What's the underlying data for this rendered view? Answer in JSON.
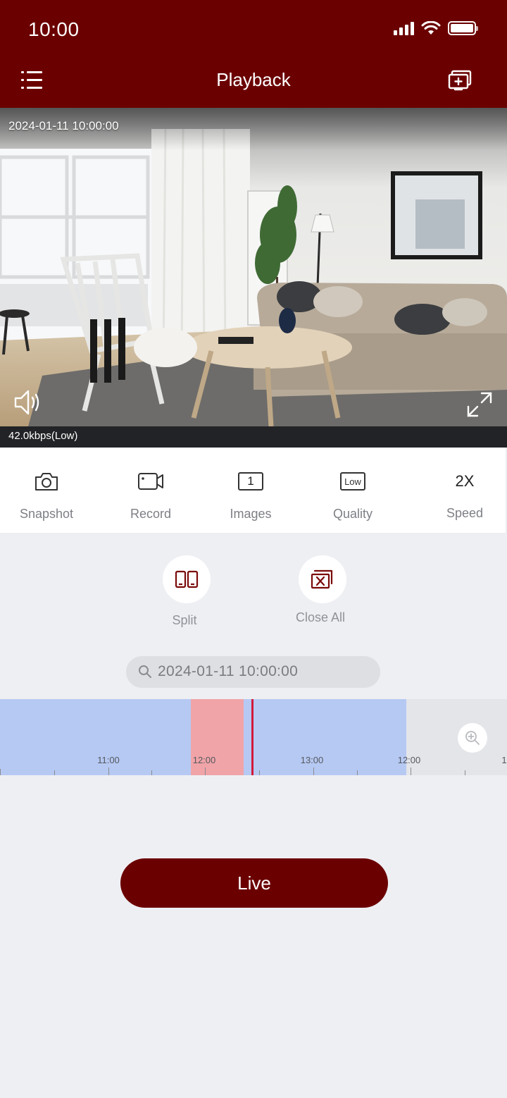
{
  "status_bar": {
    "time": "10:00",
    "icons": [
      "signal-icon",
      "wifi-icon",
      "battery-icon"
    ]
  },
  "header": {
    "title": "Playback",
    "left_icon": "menu-icon",
    "right_icon": "screen-add-icon",
    "background": "#6b0000"
  },
  "video": {
    "timestamp": "2024-01-11 10:00:00",
    "bitrate": "42.0kbps(Low)",
    "sound_icon": "speaker-icon",
    "fullscreen_icon": "expand-icon"
  },
  "toolbar": {
    "items": [
      {
        "label": "Snapshot",
        "icon": "camera-icon"
      },
      {
        "label": "Record",
        "icon": "video-camera-icon"
      },
      {
        "label": "Images",
        "icon": "image-count-icon",
        "badge": "1"
      },
      {
        "label": "Quality",
        "icon": "quality-icon",
        "badge": "Low"
      },
      {
        "label": "Speed",
        "value": "2X"
      }
    ]
  },
  "actions": {
    "split_label": "Split",
    "close_all_label": "Close All"
  },
  "search": {
    "value": "2024-01-11 10:00:00",
    "icon": "search-icon"
  },
  "timeline": {
    "tick_labels": [
      "11:00",
      "12:00",
      "13:00",
      "12:00",
      "1"
    ],
    "colors": {
      "recorded": "#b6c9f3",
      "alarm": "#f0a4a8",
      "playhead": "#d2193b",
      "empty": "#e4e5e9"
    },
    "zoom_icon": "zoom-in-icon"
  },
  "live_label": "Live",
  "colors": {
    "brand": "#6b0000",
    "background": "#eeeff3"
  }
}
